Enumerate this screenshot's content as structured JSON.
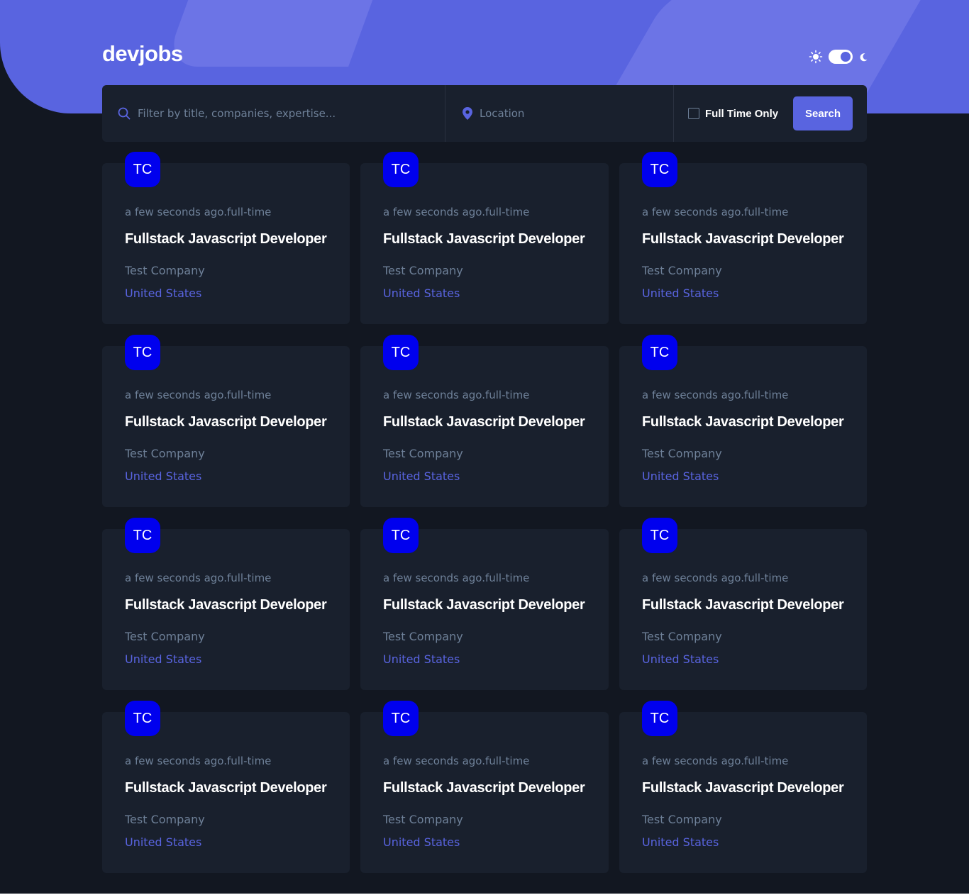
{
  "header": {
    "logo": "devjobs"
  },
  "filter": {
    "title_placeholder": "Filter by title, companies, expertise...",
    "location_placeholder": "Location",
    "full_time_label": "Full Time Only",
    "search_label": "Search"
  },
  "colors": {
    "accent": "#5964E0",
    "logo_badge": "#0000EE",
    "background": "#121721",
    "card": "#19202D"
  },
  "jobs": [
    {
      "logo": "TC",
      "meta": "a few seconds ago.full-time",
      "title": "Fullstack Javascript Developer",
      "company": "Test Company",
      "location": "United States"
    },
    {
      "logo": "TC",
      "meta": "a few seconds ago.full-time",
      "title": "Fullstack Javascript Developer",
      "company": "Test Company",
      "location": "United States"
    },
    {
      "logo": "TC",
      "meta": "a few seconds ago.full-time",
      "title": "Fullstack Javascript Developer",
      "company": "Test Company",
      "location": "United States"
    },
    {
      "logo": "TC",
      "meta": "a few seconds ago.full-time",
      "title": "Fullstack Javascript Developer",
      "company": "Test Company",
      "location": "United States"
    },
    {
      "logo": "TC",
      "meta": "a few seconds ago.full-time",
      "title": "Fullstack Javascript Developer",
      "company": "Test Company",
      "location": "United States"
    },
    {
      "logo": "TC",
      "meta": "a few seconds ago.full-time",
      "title": "Fullstack Javascript Developer",
      "company": "Test Company",
      "location": "United States"
    },
    {
      "logo": "TC",
      "meta": "a few seconds ago.full-time",
      "title": "Fullstack Javascript Developer",
      "company": "Test Company",
      "location": "United States"
    },
    {
      "logo": "TC",
      "meta": "a few seconds ago.full-time",
      "title": "Fullstack Javascript Developer",
      "company": "Test Company",
      "location": "United States"
    },
    {
      "logo": "TC",
      "meta": "a few seconds ago.full-time",
      "title": "Fullstack Javascript Developer",
      "company": "Test Company",
      "location": "United States"
    },
    {
      "logo": "TC",
      "meta": "a few seconds ago.full-time",
      "title": "Fullstack Javascript Developer",
      "company": "Test Company",
      "location": "United States"
    },
    {
      "logo": "TC",
      "meta": "a few seconds ago.full-time",
      "title": "Fullstack Javascript Developer",
      "company": "Test Company",
      "location": "United States"
    },
    {
      "logo": "TC",
      "meta": "a few seconds ago.full-time",
      "title": "Fullstack Javascript Developer",
      "company": "Test Company",
      "location": "United States"
    }
  ]
}
